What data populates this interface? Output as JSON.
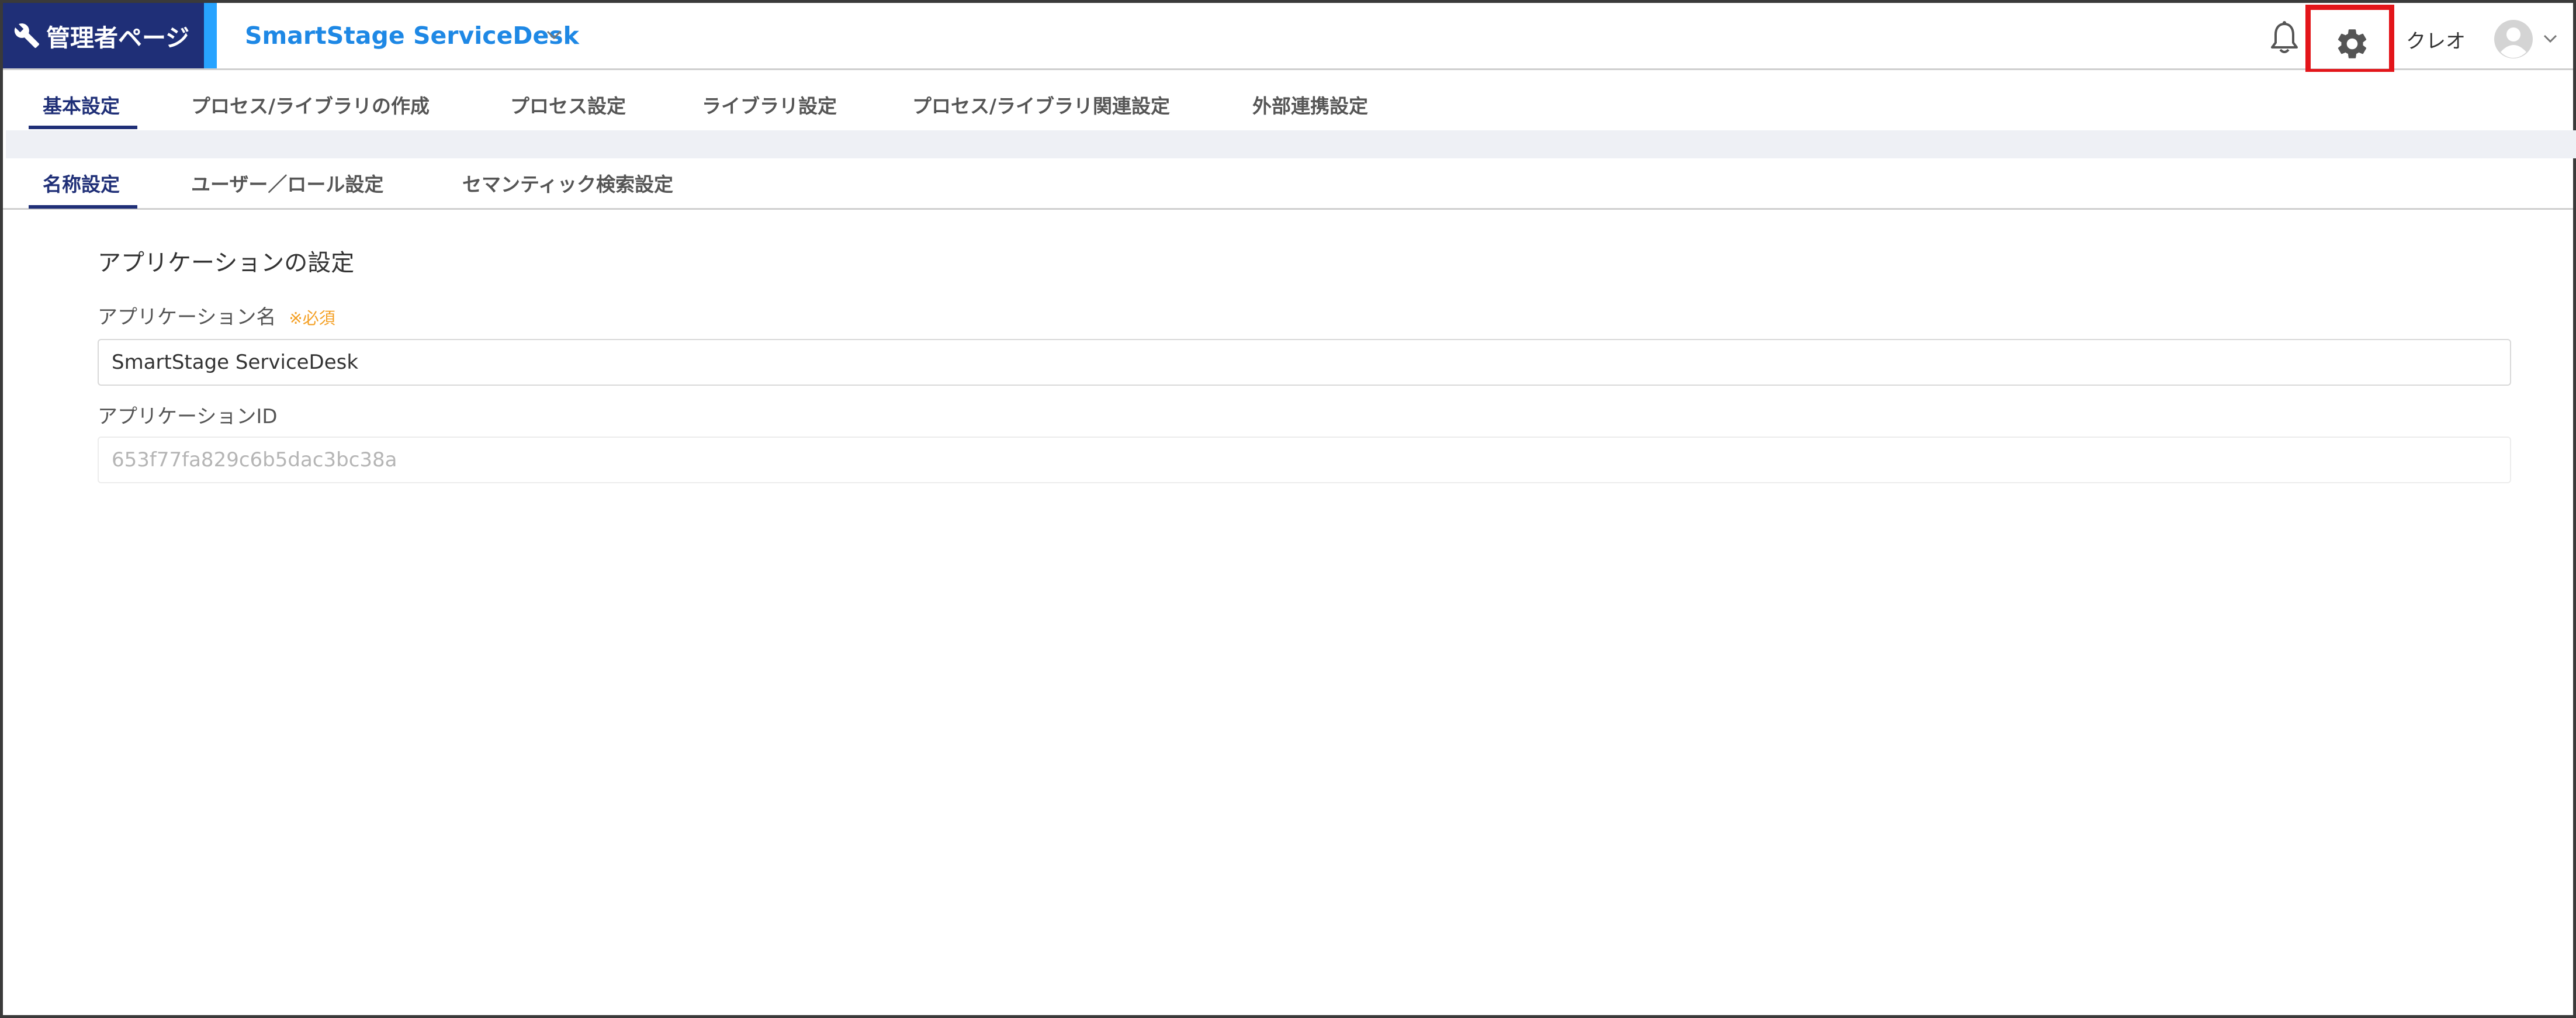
{
  "header": {
    "admin_label": "管理者ページ",
    "app_title": "SmartStage ServiceDesk",
    "user_name": "クレオ",
    "icons": {
      "wrench": "wrench-icon",
      "bell": "bell-icon",
      "gear": "gear-icon",
      "avatar": "user-avatar-icon",
      "chevron": "chevron-down-icon"
    },
    "colors": {
      "admin_bg": "#1f2f77",
      "accent": "#27a3ff",
      "title": "#1e88e5",
      "highlight": "#e3151a"
    }
  },
  "main_tabs": [
    {
      "label": "基本設定",
      "active": true
    },
    {
      "label": "プロセス/ライブラリの作成",
      "active": false
    },
    {
      "label": "プロセス設定",
      "active": false
    },
    {
      "label": "ライブラリ設定",
      "active": false
    },
    {
      "label": "プロセス/ライブラリ関連設定",
      "active": false
    },
    {
      "label": "外部連携設定",
      "active": false
    }
  ],
  "sub_tabs": [
    {
      "label": "名称設定",
      "active": true
    },
    {
      "label": "ユーザー／ロール設定",
      "active": false
    },
    {
      "label": "セマンティック検索設定",
      "active": false
    }
  ],
  "form": {
    "section_title": "アプリケーションの設定",
    "app_name_label": "アプリケーション名",
    "required_mark": "※必須",
    "app_name_value": "SmartStage ServiceDesk",
    "app_id_label": "アプリケーションID",
    "app_id_value": "653f77fa829c6b5dac3bc38a"
  }
}
